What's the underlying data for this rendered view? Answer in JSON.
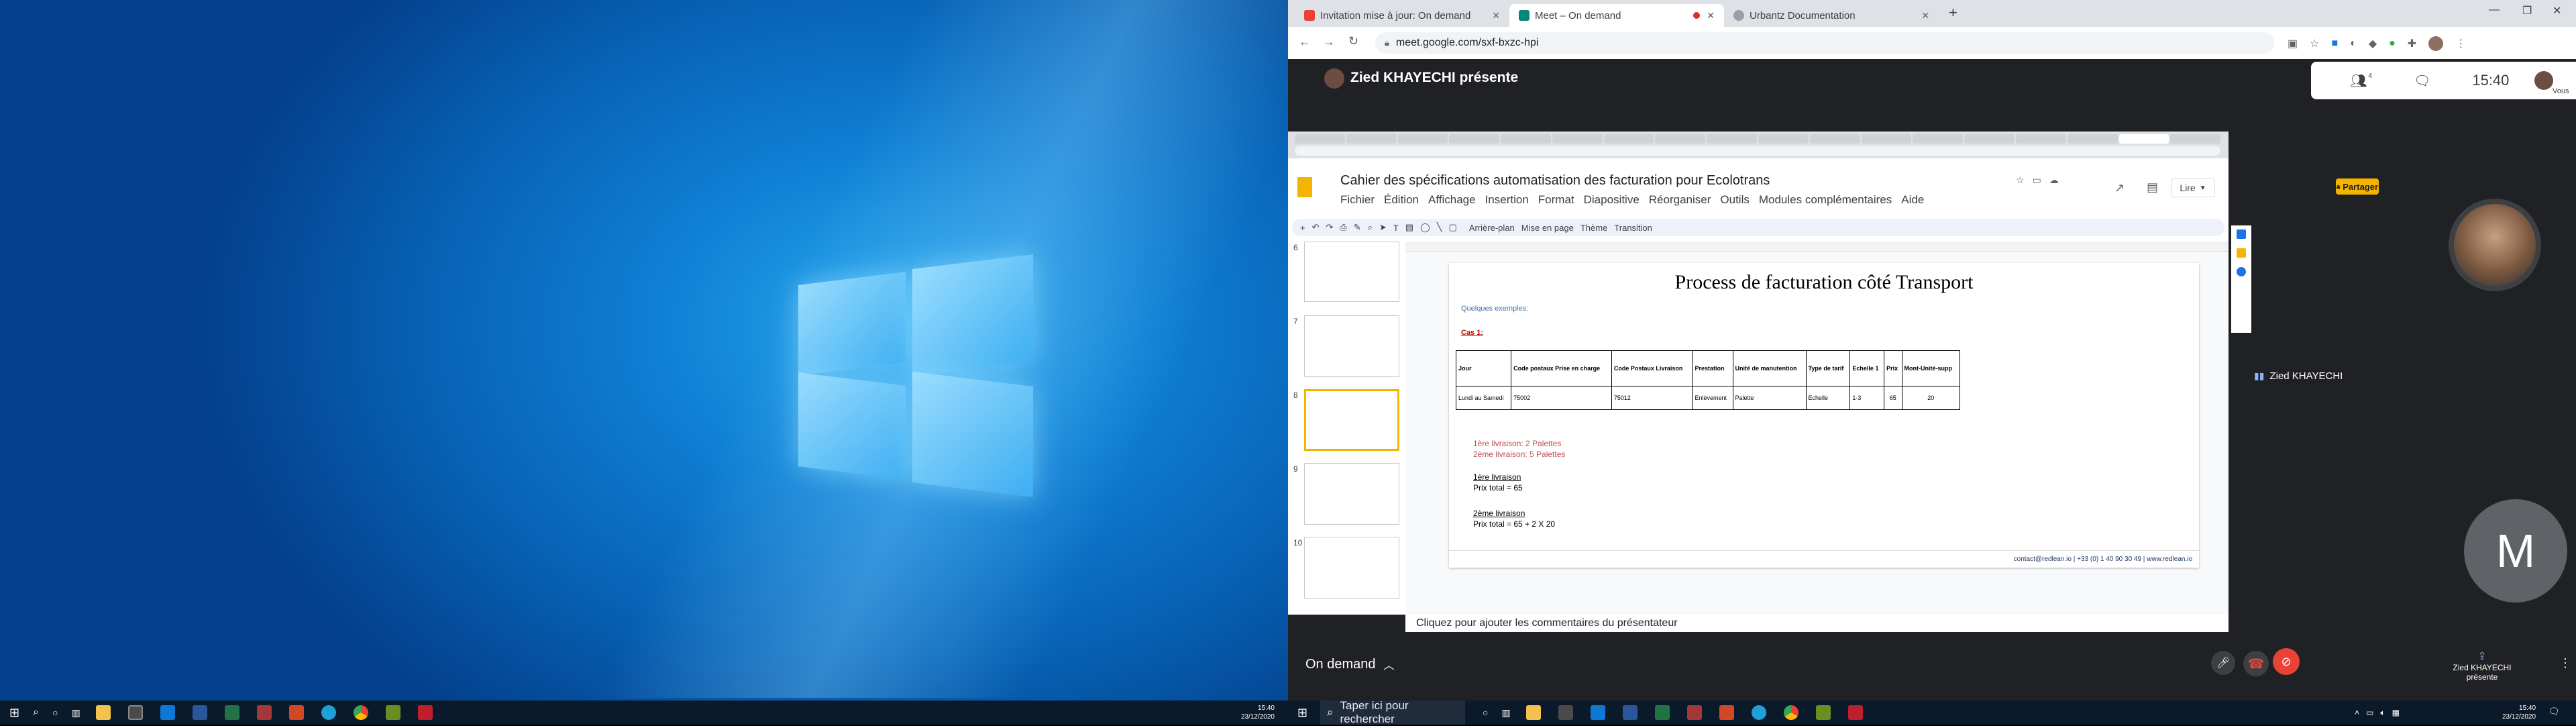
{
  "left_screen": {
    "taskbar": {
      "clock_time": "15:40",
      "clock_date": "23/12/2020"
    }
  },
  "browser": {
    "tabs": [
      {
        "title": "Invitation mise à jour: On demand",
        "icon": "gmail-icon"
      },
      {
        "title": "Meet – On demand",
        "icon": "meet-icon",
        "active": true
      },
      {
        "title": "Urbantz Documentation",
        "icon": "globe-icon"
      }
    ],
    "url": "meet.google.com/sxf-bxzc-hpi"
  },
  "meet": {
    "presenter_banner": "Zied KHAYECHI présente",
    "time": "15:40",
    "participants_count": "4",
    "self_label": "Vous",
    "meeting_name": "On demand",
    "participant1_name": "Zied KHAYECHI",
    "participant2_initial": "M",
    "presenting_label": "Zied KHAYECHI présente"
  },
  "slides": {
    "doc_title": "Cahier des spécifications automatisation des facturation pour Ecolotrans",
    "menu": [
      "Fichier",
      "Édition",
      "Affichage",
      "Insertion",
      "Format",
      "Diapositive",
      "Réorganiser",
      "Outils",
      "Modules complémentaires",
      "Aide"
    ],
    "toolbar_items": [
      "Arrière-plan",
      "Mise en page",
      "Thème",
      "Transition"
    ],
    "present_label": "Lire",
    "share_label": "Partager",
    "slide_numbers": [
      "6",
      "7",
      "8",
      "9",
      "10"
    ],
    "notes_placeholder": "Cliquez pour ajouter les commentaires du présentateur",
    "slide": {
      "title": "Process de facturation côté Transport",
      "examples_label": "Quelques exemples:",
      "case_label": "Cas 1:",
      "table_headers": [
        "Jour",
        "Code postaux Prise en charge",
        "Code Postaux Livraison",
        "Prestation",
        "Unité de manutention",
        "Type de tarif",
        "Echelle 1",
        "Prix",
        "Mont-Unité-supp"
      ],
      "table_row": [
        "Lundi au Samedi",
        "75002",
        "75012",
        "Enlèvement",
        "Palette",
        "Echelle",
        "1-3",
        "65",
        "20"
      ],
      "delivery_lines": [
        "1ère livraison: 2 Palettes",
        "2ème livraison: 5 Palettes"
      ],
      "first_delivery_label": "1ère livraison",
      "first_delivery_price": "Prix total = 65",
      "second_delivery_label": "2ème livraison",
      "second_delivery_price": "Prix total = 65 + 2 X 20",
      "footer": "contact@redlean.io | +33 (0) 1 40 90 30 49 | www.redlean.io"
    }
  },
  "right_taskbar": {
    "search_placeholder": "Taper ici pour rechercher",
    "clock_time": "15:40",
    "clock_date": "23/12/2020"
  },
  "colors": {
    "meet_bg": "#202124",
    "hangup_red": "#ea4335",
    "share_yellow": "#f4b400"
  }
}
